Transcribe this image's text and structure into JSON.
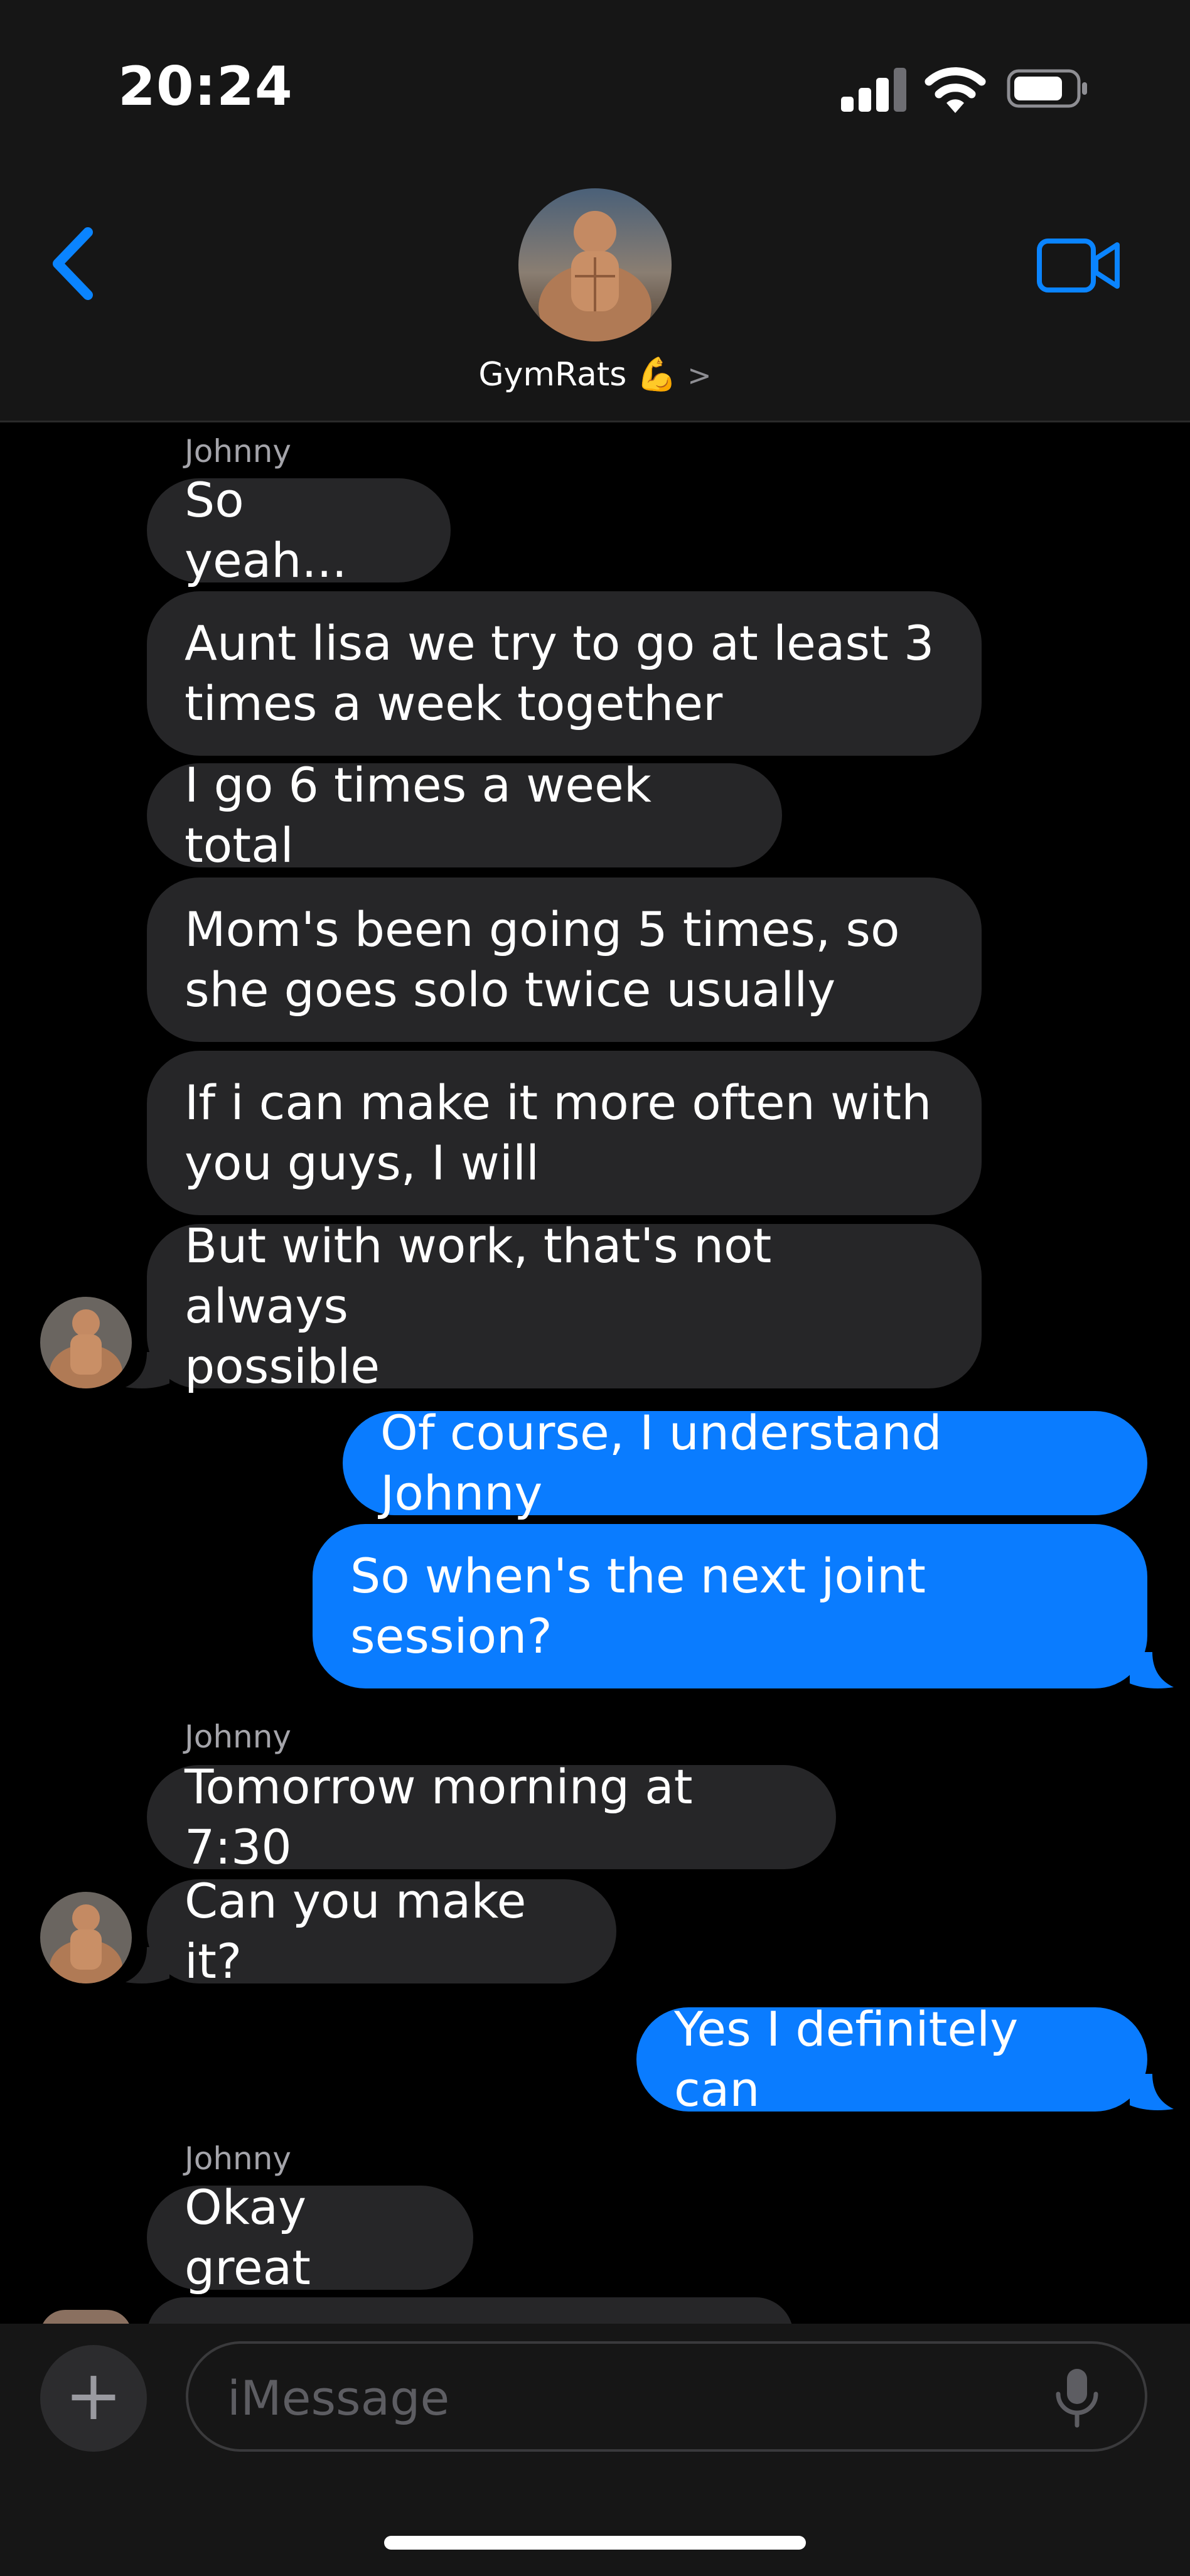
{
  "status_bar": {
    "time": "20:24"
  },
  "header": {
    "group_name": "GymRats",
    "group_emoji": "💪",
    "chevron": ">",
    "back_icon": "chevron-left-icon",
    "video_icon": "video-camera-icon",
    "accent": "#0a84ff"
  },
  "messages": [
    {
      "sender": "Johnny"
    },
    {
      "text": "So yeah..."
    },
    {
      "text_line1": "Aunt lisa we try to go at least 3",
      "text_line2": "times a week together"
    },
    {
      "text": "I go 6 times a week total"
    },
    {
      "text_line1": "Mom's been going 5 times, so",
      "text_line2": "she goes solo twice usually"
    },
    {
      "text_line1": "If i can make it more often with",
      "text_line2": "you guys, I will"
    },
    {
      "text_line1": "But with work, that's not always",
      "text_line2": "possible"
    },
    {
      "text": "Of course, I understand Johnny"
    },
    {
      "text_line1": "So when's the next joint",
      "text_line2": "session?"
    },
    {
      "sender": "Johnny"
    },
    {
      "text": "Tomorrow morning at 7:30"
    },
    {
      "text": "Can you make it?"
    },
    {
      "text": "Yes I definitely can"
    },
    {
      "sender": "Johnny"
    },
    {
      "text": "Okay great"
    }
  ],
  "composer": {
    "placeholder": "iMessage",
    "plus_label": "+",
    "mic_icon": "microphone-icon"
  },
  "colors": {
    "incoming": "#262628",
    "outgoing": "#0a7cff",
    "background": "#000000"
  }
}
